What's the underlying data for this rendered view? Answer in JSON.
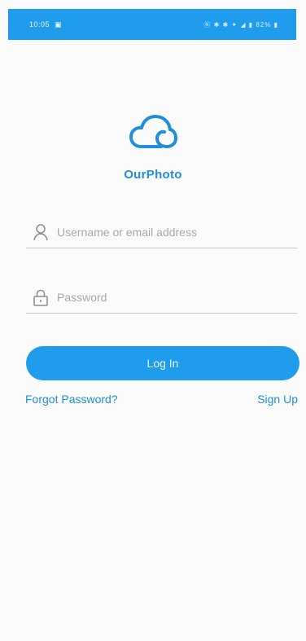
{
  "status_bar": {
    "time": "10:05",
    "right_text": "Ⓝ ✱ ✱ ✦ ◢ ▮ 82% ▮"
  },
  "app": {
    "name": "OurPhoto",
    "logo_icon": "cloud-icon",
    "brand_color": "#1f9cec"
  },
  "form": {
    "username": {
      "value": "",
      "placeholder": "Username or email address",
      "icon": "user-icon"
    },
    "password": {
      "value": "",
      "placeholder": "Password",
      "icon": "lock-icon"
    },
    "login_label": "Log In",
    "forgot_label": "Forgot Password?",
    "signup_label": "Sign Up"
  }
}
